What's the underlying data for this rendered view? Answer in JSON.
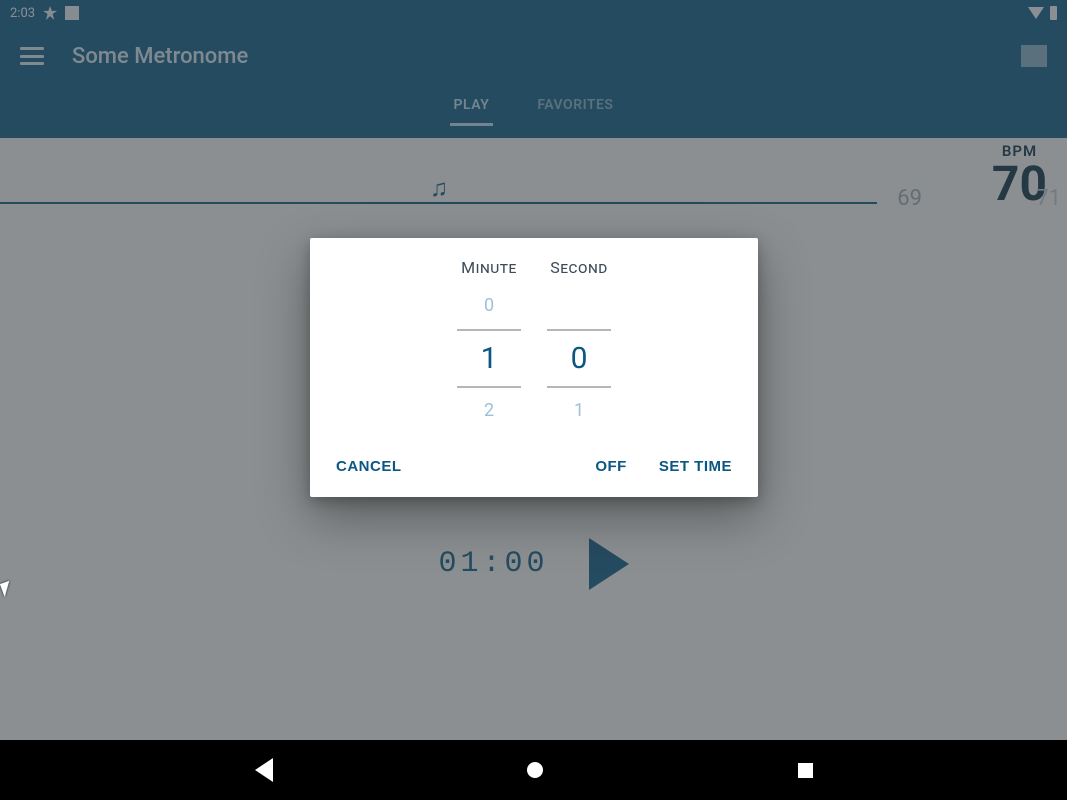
{
  "status": {
    "time": "2:03"
  },
  "app": {
    "title": "Some Metronome"
  },
  "tabs": {
    "play": "PLAY",
    "favorites": "FAVORITES"
  },
  "bpm": {
    "label": "BPM",
    "prev": "69",
    "value": "70",
    "next": "71"
  },
  "timer": {
    "display": "01:00"
  },
  "dialog": {
    "minute_label": "Minute",
    "second_label": "Second",
    "minute_above": "0",
    "minute_selected": "1",
    "minute_below": "2",
    "second_above": "",
    "second_selected": "0",
    "second_below": "1",
    "cancel": "CANCEL",
    "off": "OFF",
    "set_time": "SET TIME"
  }
}
